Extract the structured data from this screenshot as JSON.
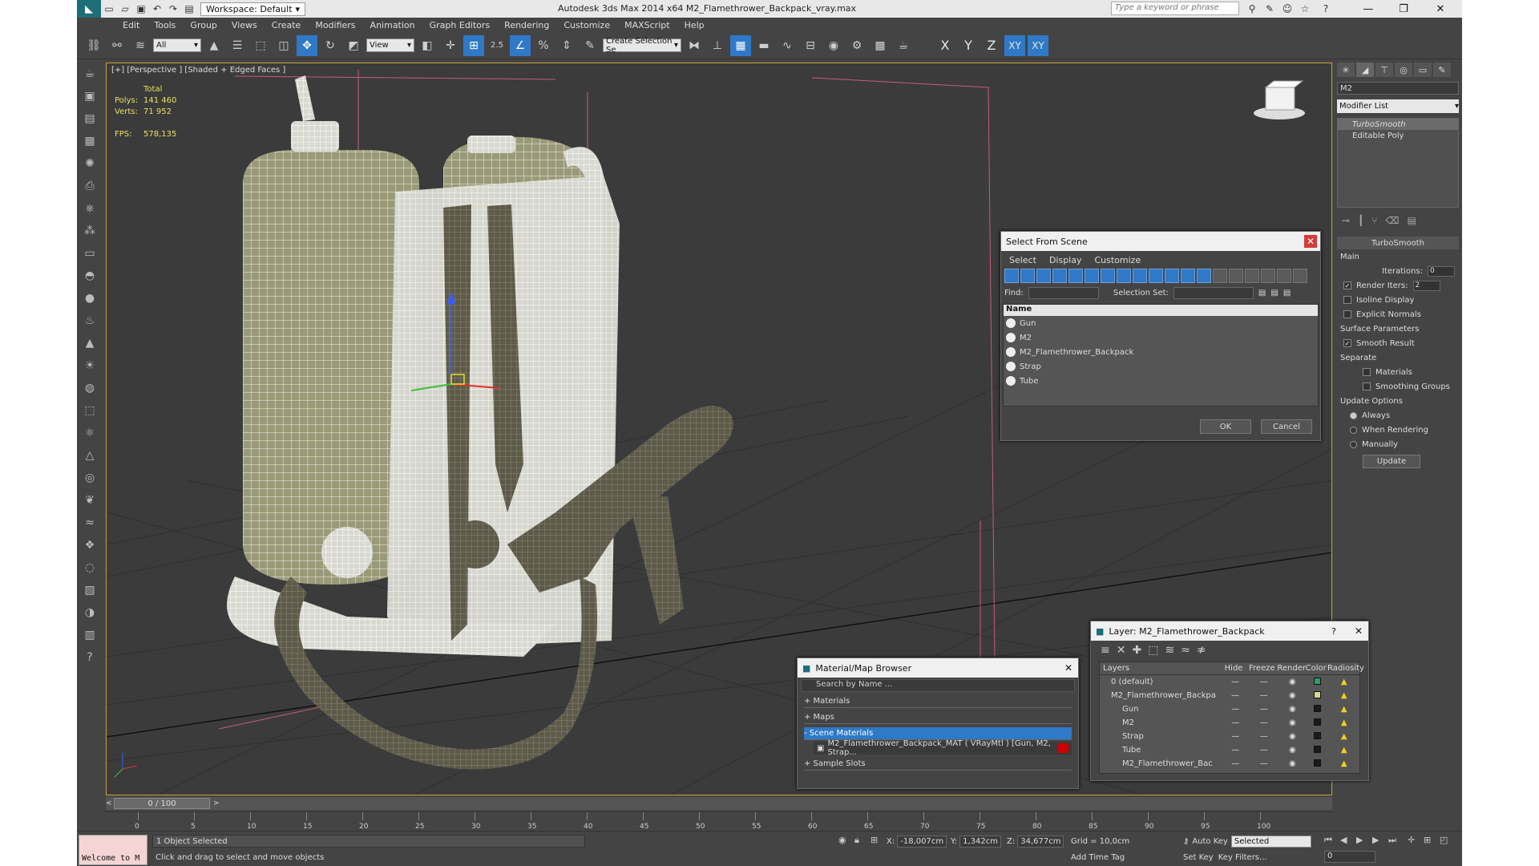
{
  "window": {
    "title": "Autodesk 3ds Max  2014 x64     M2_Flamethrower_Backpack_vray.max",
    "workspace": "Workspace: Default",
    "search_placeholder": "Type a keyword or phrase"
  },
  "menu": [
    "Edit",
    "Tools",
    "Group",
    "Views",
    "Create",
    "Modifiers",
    "Animation",
    "Graph Editors",
    "Rendering",
    "Customize",
    "MAXScript",
    "Help"
  ],
  "toolbar": {
    "filter_value": "All",
    "ref_coord": "View",
    "selection_set": "Create Selection Se",
    "snap_label": "2.5",
    "axes": [
      "X",
      "Y",
      "Z",
      "XY",
      "XY"
    ]
  },
  "viewport": {
    "label": "[+] [Perspective ] [Shaded + Edged Faces ]",
    "stats": {
      "total": "Total",
      "polys_label": "Polys:",
      "polys": "141 460",
      "verts_label": "Verts:",
      "verts": "71 952",
      "fps_label": "FPS:",
      "fps": "578,135"
    }
  },
  "select_from_scene": {
    "title": "Select From Scene",
    "menu": [
      "Select",
      "Display",
      "Customize"
    ],
    "find_label": "Find:",
    "selection_set_label": "Selection Set:",
    "column": "Name",
    "items": [
      "Gun",
      "M2",
      "M2_Flamethrower_Backpack",
      "Strap",
      "Tube"
    ],
    "ok": "OK",
    "cancel": "Cancel"
  },
  "material_browser": {
    "title": "Material/Map Browser",
    "search_placeholder": "Search by Name ...",
    "groups": [
      "+ Materials",
      "+ Maps",
      "- Scene Materials"
    ],
    "material": "M2_Flamethrower_Backpack_MAT  ( VRayMtl )  [Gun, M2, Strap...",
    "sample_slots": "+ Sample Slots"
  },
  "layer_window": {
    "title": "Layer: M2_Flamethrower_Backpack",
    "columns": [
      "Layers",
      "Hide",
      "Freeze",
      "Render",
      "Color",
      "Radiosity"
    ],
    "rows": [
      {
        "name": "0 (default)",
        "color": "#2f9a6a"
      },
      {
        "name": "M2_Flamethrower_Backpa",
        "color": "#d8d890"
      },
      {
        "name": "Gun",
        "color": "#1a1a1a"
      },
      {
        "name": "M2",
        "color": "#1a1a1a"
      },
      {
        "name": "Strap",
        "color": "#1a1a1a"
      },
      {
        "name": "Tube",
        "color": "#1a1a1a"
      },
      {
        "name": "M2_Flamethrower_Bac",
        "color": "#1a1a1a"
      }
    ]
  },
  "command_panel": {
    "object_name": "M2",
    "modifier_list": "Modifier List",
    "stack": [
      "TurboSmooth",
      "Editable Poly"
    ],
    "rollout_title": "TurboSmooth",
    "main_label": "Main",
    "iterations_label": "Iterations:",
    "iterations": "0",
    "render_iters_label": "Render Iters:",
    "render_iters": "2",
    "isoline": "Isoline Display",
    "explicit_normals": "Explicit Normals",
    "surface_params": "Surface Parameters",
    "smooth_result": "Smooth Result",
    "separate": "Separate",
    "materials": "Materials",
    "smoothing_groups": "Smoothing Groups",
    "update_options": "Update Options",
    "always": "Always",
    "when_rendering": "When Rendering",
    "manually": "Manually",
    "update_button": "Update"
  },
  "timeline": {
    "slider": "0 / 100",
    "ticks": [
      "0",
      "5",
      "10",
      "15",
      "20",
      "25",
      "30",
      "35",
      "40",
      "45",
      "50",
      "55",
      "60",
      "65",
      "70",
      "75",
      "80",
      "85",
      "90",
      "95",
      "100"
    ]
  },
  "status": {
    "welcome": "Welcome to M",
    "selected": "1 Object Selected",
    "prompt": "Click and drag to select and move objects",
    "x_label": "X:",
    "x": "-18,007cm",
    "y_label": "Y:",
    "y": "1,342cm",
    "z_label": "Z:",
    "z": "34,677cm",
    "grid": "Grid = 10,0cm",
    "add_time_tag": "Add Time Tag",
    "auto_key": "Auto Key",
    "selected_dd": "Selected",
    "set_key": "Set Key",
    "key_filters": "Key Filters...",
    "frame": "0"
  },
  "colors": {
    "accent": "#2f79c7",
    "viewport_border": "#c8a23a",
    "stats": "#e9e063"
  }
}
